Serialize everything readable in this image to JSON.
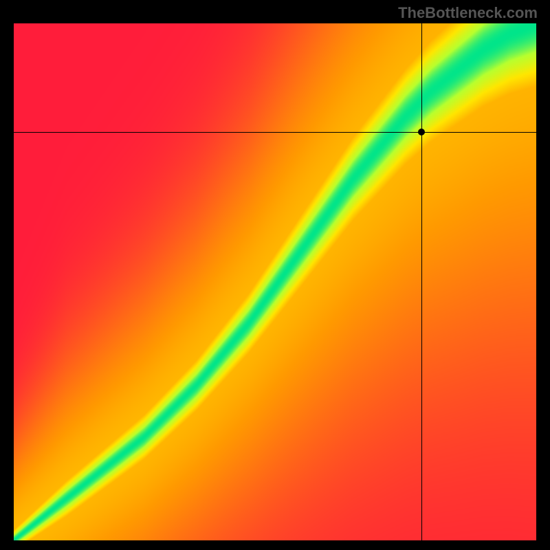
{
  "watermark": "TheBottleneck.com",
  "chart_data": {
    "type": "heatmap",
    "title": "",
    "xlabel": "",
    "ylabel": "",
    "xlim": [
      0,
      100
    ],
    "ylim": [
      0,
      100
    ],
    "crosshair": {
      "x": 78,
      "y": 79
    },
    "colormap": {
      "stops": [
        {
          "t": 0.0,
          "color": "#ff1d3a"
        },
        {
          "t": 0.45,
          "color": "#ff9a00"
        },
        {
          "t": 0.7,
          "color": "#ffe600"
        },
        {
          "t": 0.88,
          "color": "#b8ff2e"
        },
        {
          "t": 1.0,
          "color": "#00e58a"
        }
      ]
    },
    "ridge": {
      "comment": "optimal (green) ridge center y as function of x (0-100); width is half-width of green band",
      "points": [
        {
          "x": 0,
          "y": 0,
          "width": 1
        },
        {
          "x": 5,
          "y": 4,
          "width": 1.5
        },
        {
          "x": 10,
          "y": 8,
          "width": 2
        },
        {
          "x": 15,
          "y": 12,
          "width": 2.2
        },
        {
          "x": 20,
          "y": 16,
          "width": 2.4
        },
        {
          "x": 25,
          "y": 20,
          "width": 2.6
        },
        {
          "x": 30,
          "y": 25,
          "width": 2.8
        },
        {
          "x": 35,
          "y": 30,
          "width": 3.0
        },
        {
          "x": 40,
          "y": 36,
          "width": 3.3
        },
        {
          "x": 45,
          "y": 42,
          "width": 3.6
        },
        {
          "x": 50,
          "y": 49,
          "width": 4.0
        },
        {
          "x": 55,
          "y": 56,
          "width": 4.4
        },
        {
          "x": 60,
          "y": 63,
          "width": 4.8
        },
        {
          "x": 65,
          "y": 70,
          "width": 5.2
        },
        {
          "x": 70,
          "y": 76,
          "width": 5.6
        },
        {
          "x": 75,
          "y": 82,
          "width": 6.0
        },
        {
          "x": 80,
          "y": 87,
          "width": 6.4
        },
        {
          "x": 85,
          "y": 91,
          "width": 6.8
        },
        {
          "x": 90,
          "y": 95,
          "width": 7.2
        },
        {
          "x": 95,
          "y": 98,
          "width": 7.6
        },
        {
          "x": 100,
          "y": 100,
          "width": 8.0
        }
      ]
    }
  }
}
